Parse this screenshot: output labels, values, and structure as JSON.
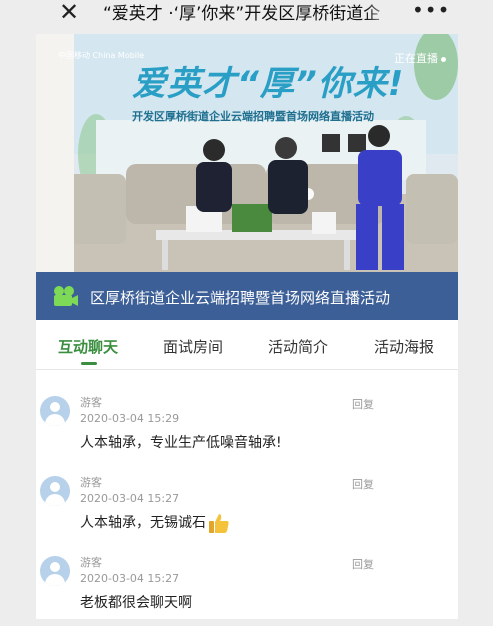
{
  "header": {
    "close_icon": "close-icon",
    "title": "“爱英才 ·‘厚’你来”开发区厚桥街道企",
    "more_icon": "more-icon",
    "more_glyph": "•••"
  },
  "video": {
    "live_label": "正在直播",
    "logo_text": "中国移动 China Mobile",
    "banner_headline": "爱英才“厚”你来!",
    "banner_sub": "开发区厚桥街道企业云端招聘暨首场网络直播活动",
    "caption_icon": "video-camera-icon",
    "caption": "区厚桥街道企业云端招聘暨首场网络直播活动",
    "colors": {
      "caption_bar": "#3c5f97"
    }
  },
  "tabs": [
    {
      "label": "互动聊天",
      "active": true
    },
    {
      "label": "面试房间",
      "active": false
    },
    {
      "label": "活动简介",
      "active": false
    },
    {
      "label": "活动海报",
      "active": false
    }
  ],
  "messages": [
    {
      "author": "游客",
      "reply": "回复",
      "time": "2020-03-04 15:29",
      "text": "人本轴承，专业生产低噪音轴承!"
    },
    {
      "author": "游客",
      "reply": "回复",
      "time": "2020-03-04 15:27",
      "text": "人本轴承，无锡诚石",
      "emoji": "thumbs-up-icon"
    },
    {
      "author": "游客",
      "reply": "回复",
      "time": "2020-03-04 15:27",
      "text": "老板都很会聊天啊"
    }
  ],
  "colors": {
    "accent": "#3a8e3f"
  }
}
